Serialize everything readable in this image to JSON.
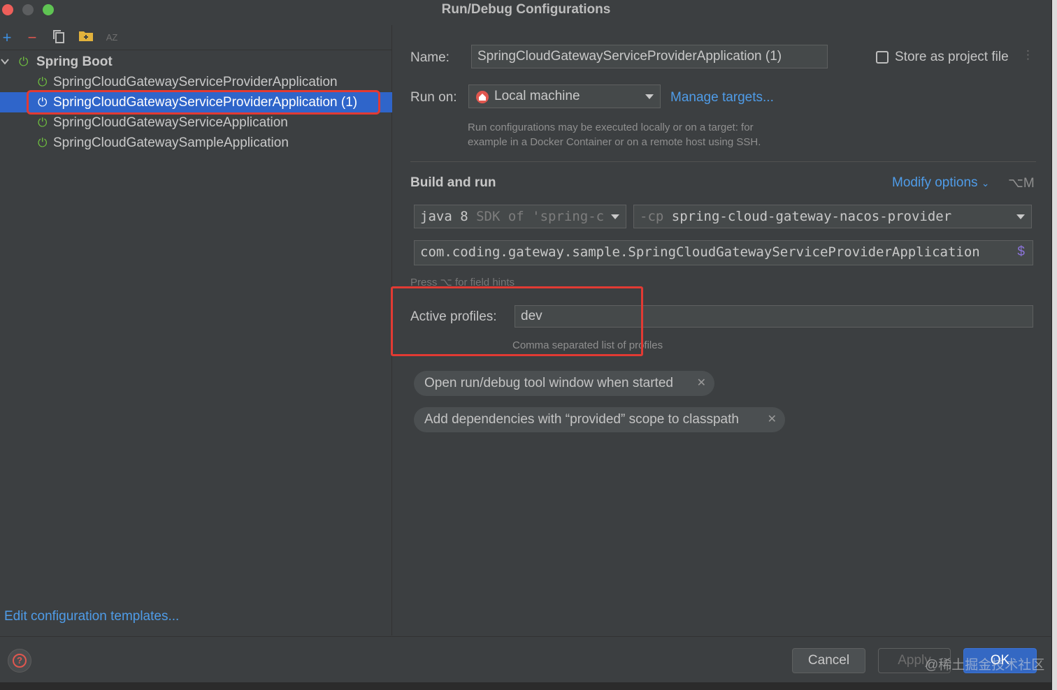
{
  "window": {
    "title": "Run/Debug Configurations"
  },
  "toolbar": {
    "add": "+",
    "remove": "−",
    "sort": "AZ"
  },
  "tree": {
    "group_label": "Spring Boot",
    "items": [
      {
        "label": "SpringCloudGatewayServiceProviderApplication"
      },
      {
        "label": "SpringCloudGatewayServiceProviderApplication (1)",
        "selected": true
      },
      {
        "label": "SpringCloudGatewayServiceApplication"
      },
      {
        "label": "SpringCloudGatewaySampleApplication"
      }
    ]
  },
  "left_footer": {
    "edit_templates": "Edit configuration templates..."
  },
  "config": {
    "name_label": "Name:",
    "name_value": "SpringCloudGatewayServiceProviderApplication (1)",
    "store_label": "Store as project file",
    "run_on_label": "Run on:",
    "run_on_value": "Local machine",
    "manage_targets": "Manage targets...",
    "run_on_hint_1": "Run configurations may be executed locally or on a target: for",
    "run_on_hint_2": "example in a Docker Container or on a remote host using SSH.",
    "section_title": "Build and run",
    "modify_options": "Modify options",
    "modify_shortcut": "⌥M",
    "jdk_main": "java 8",
    "jdk_suffix": "SDK of 'spring-c",
    "cp_prefix": "-cp",
    "cp_value": "spring-cloud-gateway-nacos-provider",
    "main_class": "com.coding.gateway.sample.SpringCloudGatewayServiceProviderApplication",
    "field_hint": "Press ⌥ for field hints",
    "profiles_label": "Active profiles:",
    "profiles_value": "dev",
    "profiles_hint": "Comma separated list of profiles",
    "chips": [
      {
        "label": "Open run/debug tool window when started"
      },
      {
        "label": "Add dependencies with “provided” scope to classpath"
      }
    ]
  },
  "footer": {
    "cancel": "Cancel",
    "apply": "Apply",
    "ok": "OK",
    "watermark": "@稀土掘金技术社区"
  },
  "colors": {
    "background": "#3c3f41",
    "selection": "#2f65ca",
    "link": "#4f9ce8",
    "highlight_box": "#e23a33",
    "run_icon": "#6fbf3f"
  }
}
